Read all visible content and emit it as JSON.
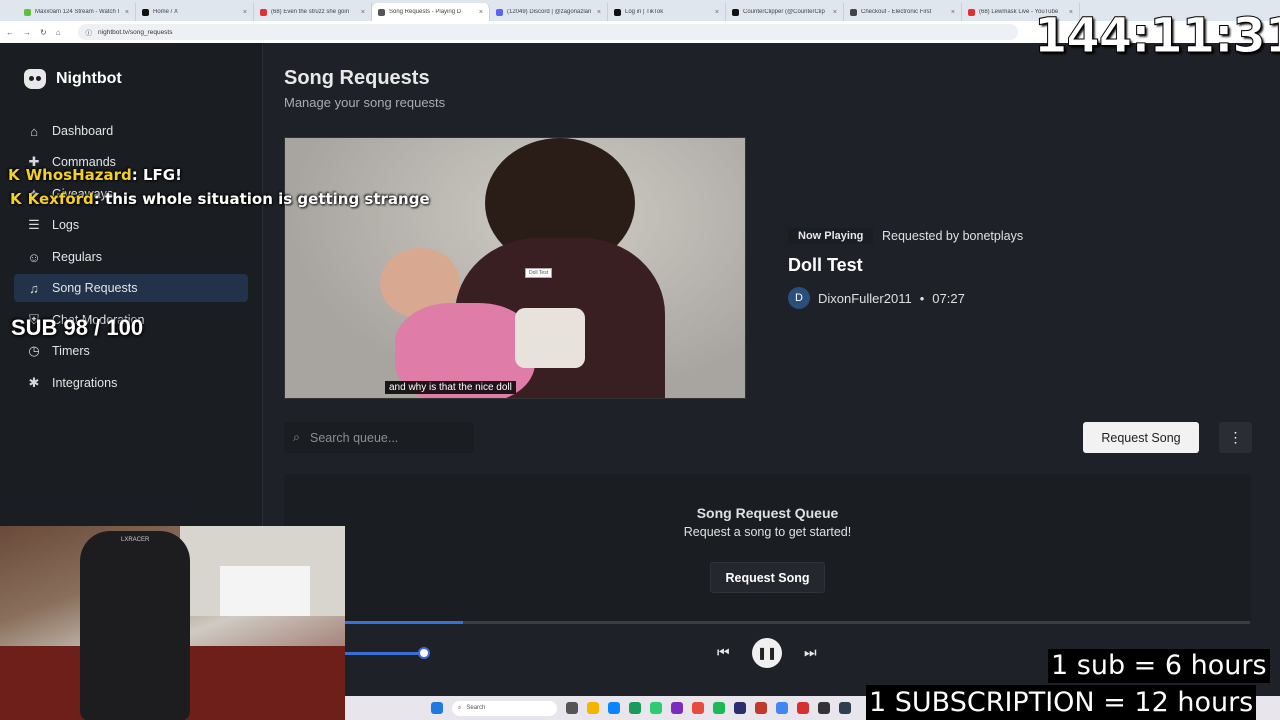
{
  "browser": {
    "tabs": [
      {
        "label": "Maxx0am 124 Stream - Watch I",
        "color": "#5fbf3a"
      },
      {
        "label": "Home / X",
        "color": "#111111"
      },
      {
        "label": "(68) Even the struzz she goin",
        "color": "#e23030"
      },
      {
        "label": "Song Requests - Playing D",
        "color": "#555555",
        "active": true
      },
      {
        "label": "(12049) Discord | @zagonazlan",
        "color": "#5865f2"
      },
      {
        "label": "Log in | TikTok",
        "color": "#111111"
      },
      {
        "label": "CounterClipper (@CounterClip",
        "color": "#111111"
      },
      {
        "label": "Checkout - Electronic First",
        "color": "#444444"
      },
      {
        "label": "(68) Lewmask Live - YouTube",
        "color": "#e23030"
      }
    ],
    "url": "nightbot.tv/song_requests"
  },
  "sidebar": {
    "brand": "Nightbot",
    "items": [
      {
        "label": "Dashboard",
        "icon": "home-icon",
        "glyph": "⌂"
      },
      {
        "label": "Commands",
        "icon": "commands-icon",
        "glyph": "✚"
      },
      {
        "label": "Giveaways",
        "icon": "gift-icon",
        "glyph": "✦"
      },
      {
        "label": "Logs",
        "icon": "list-icon",
        "glyph": "☰"
      },
      {
        "label": "Regulars",
        "icon": "users-icon",
        "glyph": "☺"
      },
      {
        "label": "Song Requests",
        "icon": "headphones-icon",
        "glyph": "♫",
        "active": true
      },
      {
        "label": "Chat Moderation",
        "icon": "shield-icon",
        "glyph": "⛨"
      },
      {
        "label": "Timers",
        "icon": "clock-icon",
        "glyph": "◷"
      },
      {
        "label": "Integrations",
        "icon": "puzzle-icon",
        "glyph": "✱"
      }
    ]
  },
  "main": {
    "title": "Song Requests",
    "subtitle": "Manage your song requests",
    "video": {
      "caption": "and why is that the nice doll",
      "tooltip": "Doll Test"
    },
    "now_playing": {
      "badge": "Now Playing",
      "requested_by": "Requested by bonetplays",
      "title": "Doll Test",
      "avatar_letter": "D",
      "channel": "DixonFuller2011",
      "separator": "•",
      "duration": "07:27"
    },
    "search": {
      "placeholder": "Search queue..."
    },
    "request_button": "Request Song",
    "queue": {
      "title": "Song Request Queue",
      "subtitle": "Request a song to get started!",
      "button": "Request Song"
    },
    "player": {
      "progress": 0.13,
      "volume": 0.9
    }
  },
  "taskbar": {
    "search_label": "Search"
  },
  "overlay": {
    "timer": "144:11:31",
    "chat": [
      {
        "prefix": "K",
        "name": "WhosHazard",
        "message": ": LFG!",
        "name_color": "#f5d020"
      },
      {
        "prefix": "K",
        "name": "Kexford",
        "message": ": this whole situation is getting strange",
        "name_color": "#f5d020"
      }
    ],
    "sub_counter": "SUB 98 / 100",
    "banner_1": "1 sub = 6 hours",
    "banner_2": "1 SUBSCRIPTION = 12 hours",
    "webcam_brand": "LXRACER"
  },
  "colors": {
    "accent": "#3b6fd8",
    "sidebar_active": "#21324a",
    "background": "#1e2127"
  }
}
